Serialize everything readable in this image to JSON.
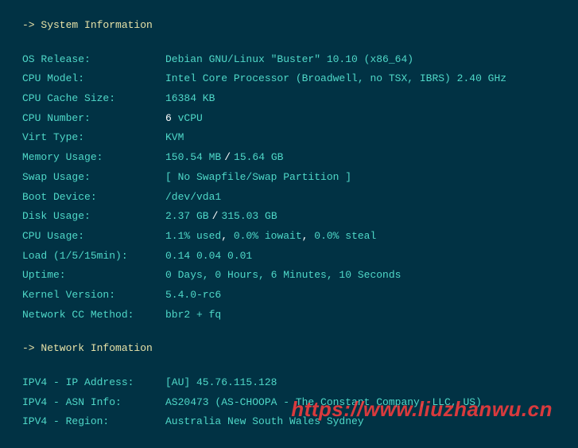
{
  "section1_header": "-> System Information",
  "section2_header": "-> Network Infomation",
  "sys": {
    "os_release": {
      "label": "OS Release:",
      "value": "Debian GNU/Linux \"Buster\" 10.10 (x86_64)"
    },
    "cpu_model": {
      "label": "CPU Model:",
      "value": "Intel Core Processor (Broadwell, no TSX, IBRS)  2.40 GHz"
    },
    "cpu_cache": {
      "label": "CPU Cache Size:",
      "value": "16384 KB"
    },
    "cpu_number": {
      "label": "CPU Number:",
      "count": "6",
      "unit": " vCPU"
    },
    "virt_type": {
      "label": "Virt Type:",
      "value": "KVM"
    },
    "mem_usage": {
      "label": "Memory Usage:",
      "used": "150.54 MB",
      "total": "15.64 GB"
    },
    "swap_usage": {
      "label": "Swap Usage:",
      "value": "[ No Swapfile/Swap Partition ]"
    },
    "boot_device": {
      "label": "Boot Device:",
      "value": "/dev/vda1"
    },
    "disk_usage": {
      "label": "Disk Usage:",
      "used": "2.37 GB",
      "total": "315.03 GB"
    },
    "cpu_usage": {
      "label": "CPU Usage:",
      "p1": "1.1% used",
      "p2": " 0.0% iowait",
      "p3": " 0.0% steal"
    },
    "load": {
      "label": "Load (1/5/15min):",
      "value": "0.14 0.04 0.01"
    },
    "uptime": {
      "label": "Uptime:",
      "value": "0 Days, 0 Hours, 6 Minutes, 10 Seconds"
    },
    "kernel": {
      "label": "Kernel Version:",
      "value": "5.4.0-rc6"
    },
    "cc_method": {
      "label": "Network CC Method:",
      "value": "bbr2 + fq"
    }
  },
  "net": {
    "ipv4_addr": {
      "label": "IPV4 - IP Address:",
      "value": "[AU] 45.76.115.128"
    },
    "ipv4_asn": {
      "label": "IPV4 - ASN Info:",
      "value": "AS20473 (AS-CHOOPA - The Constant Company, LLC, US)"
    },
    "ipv4_region": {
      "label": "IPV4 - Region:",
      "value": "Australia New South Wales Sydney"
    }
  },
  "watermark": "https://www.liuzhanwu.cn"
}
